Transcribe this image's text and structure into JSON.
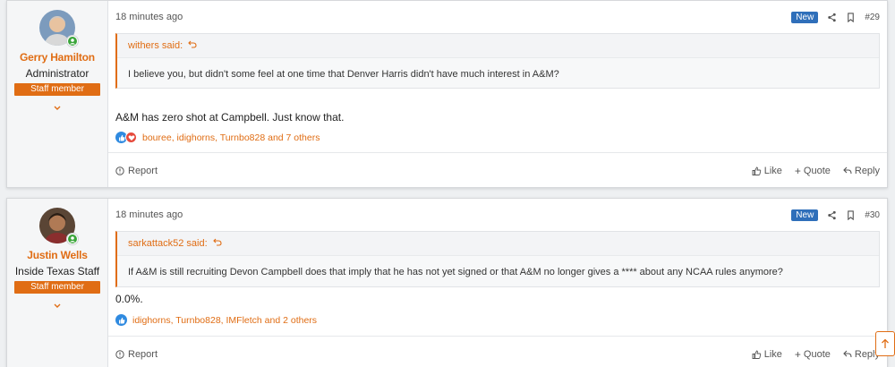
{
  "posts": [
    {
      "user": {
        "name": "Gerry Hamilton",
        "title": "Administrator",
        "badge": "Staff member",
        "avatar_icon": "user-avatar-photo"
      },
      "time": "18 minutes ago",
      "new_label": "New",
      "number": "#29",
      "quote": {
        "author": "withers said:",
        "text": "I believe you, but didn't some feel at one time that Denver Harris didn't have much interest in A&M?"
      },
      "message": "A&M has zero shot at Campbell. Just know that.",
      "reactions": {
        "icons": [
          "like-icon",
          "love-icon"
        ],
        "text": "bouree, idighorns, Turnbo828 and 7 others"
      },
      "footer": {
        "report": "Report",
        "like": "Like",
        "quote": "Quote",
        "reply": "Reply"
      }
    },
    {
      "user": {
        "name": "Justin Wells",
        "title": "Inside Texas Staff",
        "badge": "Staff member",
        "avatar_icon": "user-avatar-photo"
      },
      "time": "18 minutes ago",
      "new_label": "New",
      "number": "#30",
      "quote": {
        "author": "sarkattack52 said:",
        "text": "If A&M is still recruiting Devon Campbell does that imply that he has not yet signed or that A&M no longer gives a **** about any NCAA rules anymore?"
      },
      "message": "0.0%.",
      "reactions": {
        "icons": [
          "like-icon"
        ],
        "text": "idighorns, Turnbo828, IMFletch and 2 others"
      },
      "footer": {
        "report": "Report",
        "like": "Like",
        "quote": "Quote",
        "reply": "Reply"
      }
    }
  ],
  "colors": {
    "accent": "#e06d14",
    "new_badge": "#2f6fba",
    "like": "#2f8ae0",
    "love": "#e64a3c",
    "online": "#3aa53a"
  }
}
